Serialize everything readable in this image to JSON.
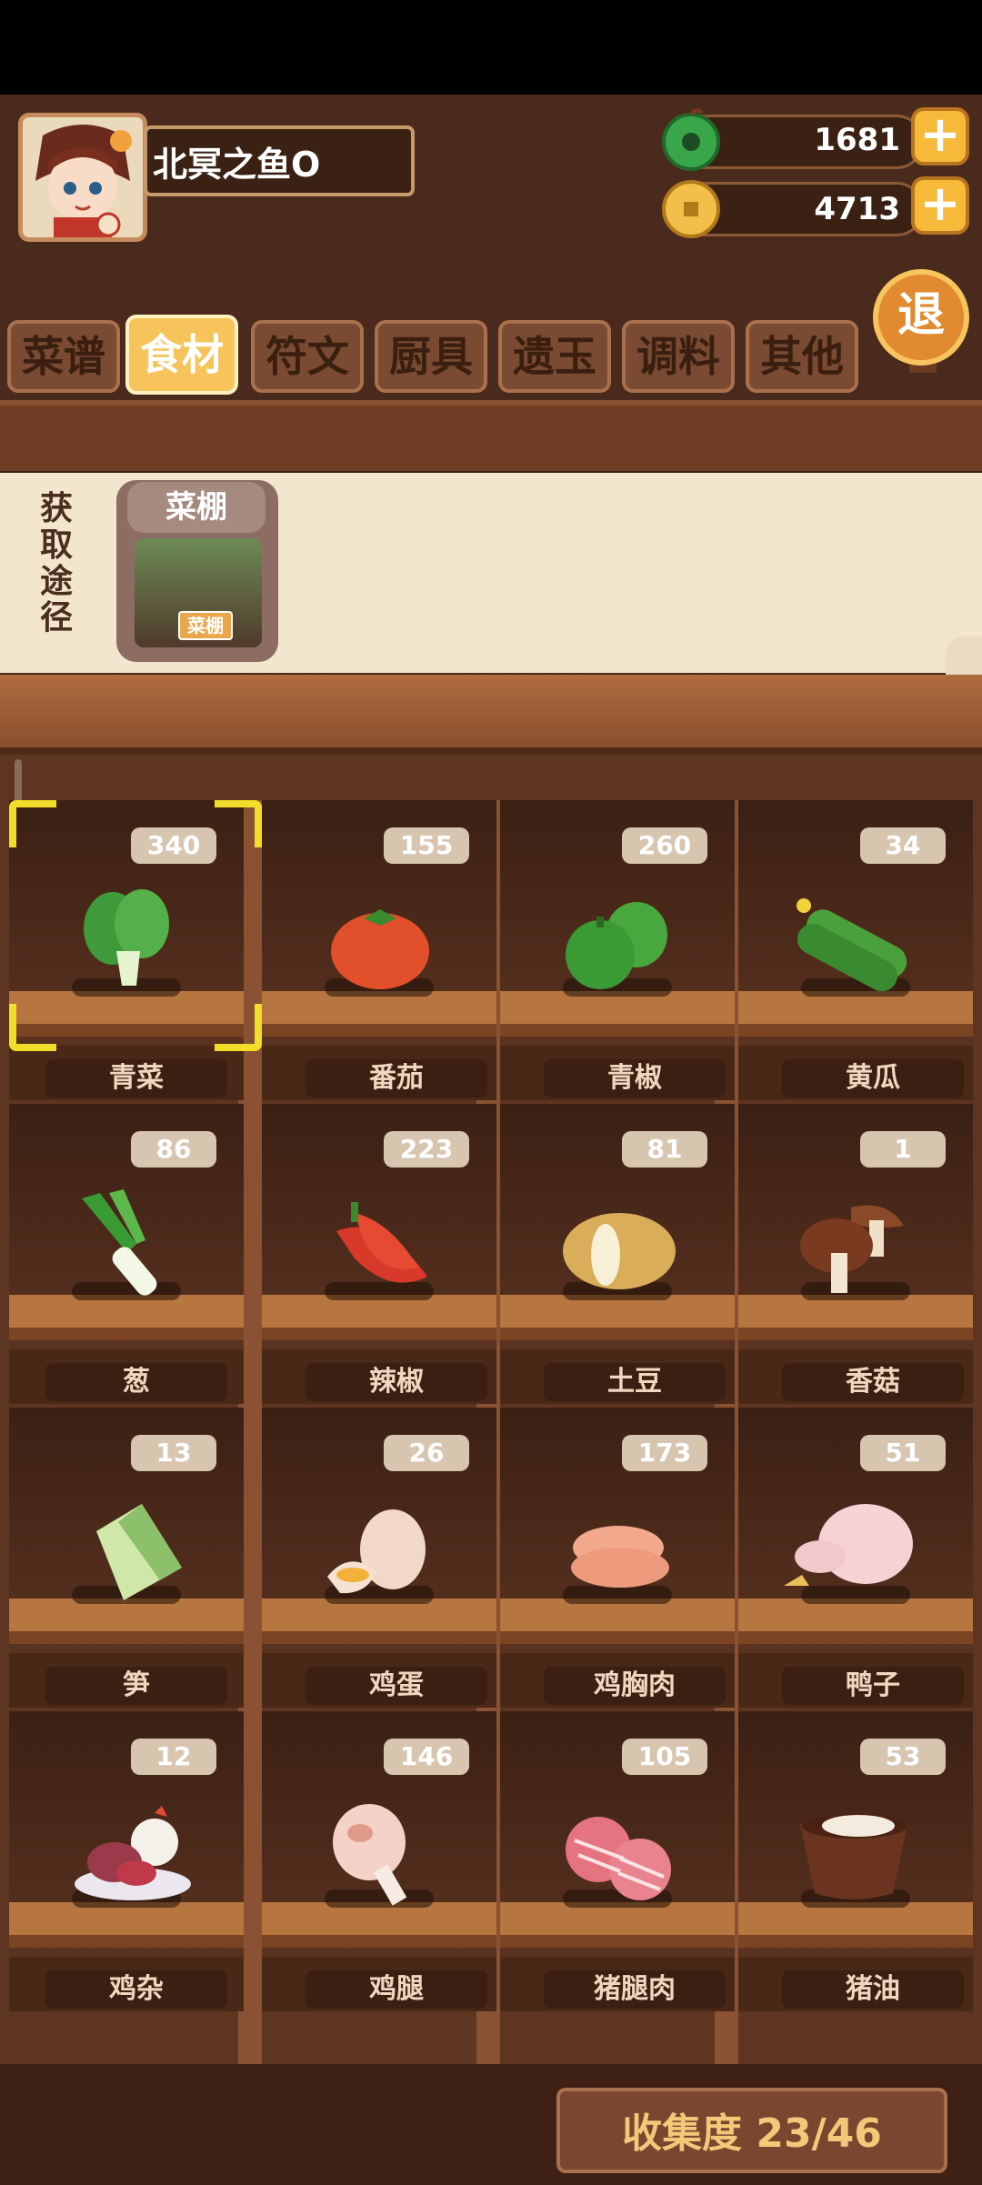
{
  "player": {
    "name": "北冥之鱼O"
  },
  "resources": {
    "jade": "1681",
    "coins": "4713"
  },
  "exit_label": "退",
  "tabs": [
    "菜谱",
    "食材",
    "符文",
    "厨具",
    "遗玉",
    "调料",
    "其他"
  ],
  "active_tab": "食材",
  "source": {
    "label": "获取途径",
    "name": "菜棚",
    "badge": "菜棚"
  },
  "ingredients": [
    {
      "name": "青菜",
      "count": "340"
    },
    {
      "name": "番茄",
      "count": "155"
    },
    {
      "name": "青椒",
      "count": "260"
    },
    {
      "name": "黄瓜",
      "count": "34"
    },
    {
      "name": "葱",
      "count": "86"
    },
    {
      "name": "辣椒",
      "count": "223"
    },
    {
      "name": "土豆",
      "count": "81"
    },
    {
      "name": "香菇",
      "count": "1"
    },
    {
      "name": "笋",
      "count": "13"
    },
    {
      "name": "鸡蛋",
      "count": "26"
    },
    {
      "name": "鸡胸肉",
      "count": "173"
    },
    {
      "name": "鸭子",
      "count": "51"
    },
    {
      "name": "鸡杂",
      "count": "12"
    },
    {
      "name": "鸡腿",
      "count": "146"
    },
    {
      "name": "猪腿肉",
      "count": "105"
    },
    {
      "name": "猪油",
      "count": "53"
    }
  ],
  "collection": {
    "label": "收集度 23/46"
  },
  "colors": {
    "accent": "#f6c45a",
    "wood": "#5e3521",
    "selection": "#f2dd2a"
  }
}
